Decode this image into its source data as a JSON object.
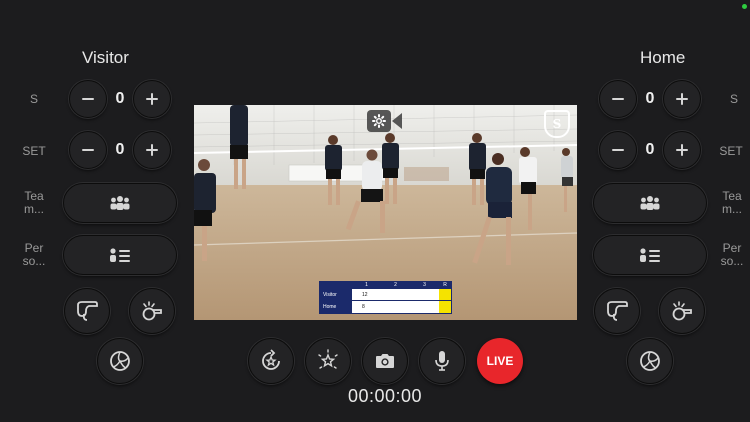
{
  "visitor": {
    "title": "Visitor",
    "set_score_label": "S",
    "set_score_value": "0",
    "sets_label": "SET",
    "sets_value": "0",
    "team_label": "Tea m...",
    "person_label": "Per so..."
  },
  "home": {
    "title": "Home",
    "set_score_label": "S",
    "set_score_value": "0",
    "sets_label": "SET",
    "sets_value": "0",
    "team_label": "Tea m...",
    "person_label": "Per so..."
  },
  "controls": {
    "live_label": "LIVE",
    "timer": "00:00:00"
  },
  "scoreboard": {
    "headers": [
      "1",
      "2",
      "3",
      "R"
    ],
    "rows": [
      {
        "team": "Visitor",
        "score": "12"
      },
      {
        "team": "Home",
        "score": "8"
      }
    ]
  },
  "colors": {
    "background": "#1c1c1e",
    "live": "#e8262b",
    "scoreboard_navy": "#1b2a6b",
    "scoreboard_highlight": "#f5e300"
  },
  "icons": {
    "decrement": "minus-icon",
    "increment": "plus-icon",
    "team": "team-group-icon",
    "person": "person-list-icon",
    "whistle": "whistle-icon",
    "ball": "volleyball-icon",
    "settings": "gear-icon",
    "camera": "camera-icon",
    "mic": "microphone-icon"
  }
}
